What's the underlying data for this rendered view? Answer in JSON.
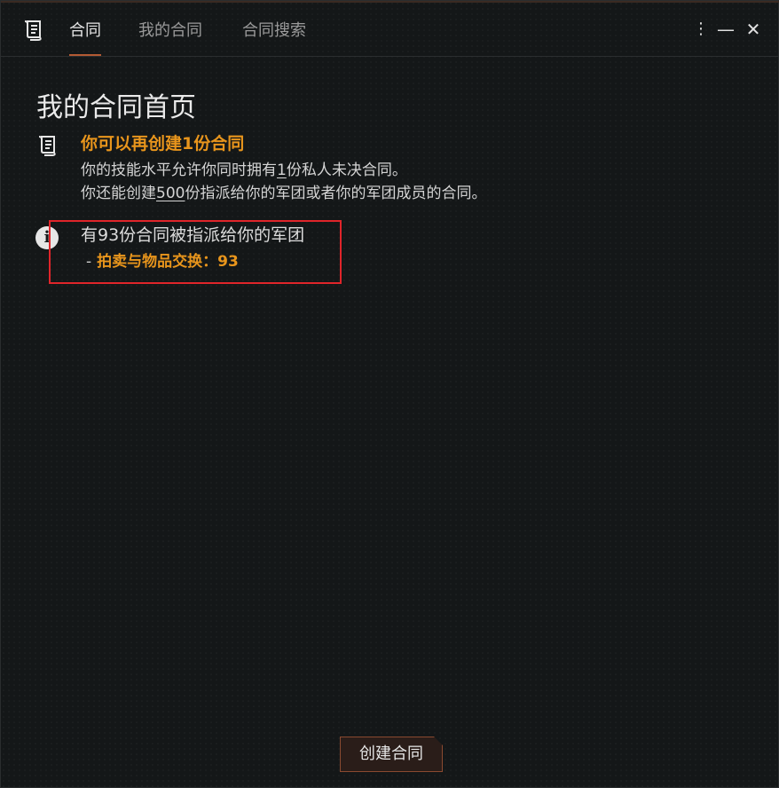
{
  "tabs": [
    {
      "label": "合同"
    },
    {
      "label": "我的合同"
    },
    {
      "label": "合同搜索"
    }
  ],
  "window_controls": {
    "more": "⋮",
    "minimize": "—",
    "close": "✕"
  },
  "main": {
    "title": "我的合同首页",
    "capacity": {
      "heading": "你可以再创建1份合同",
      "line1_prefix": "你的技能水平允许你同时拥有",
      "line1_value": "1",
      "line1_suffix": "份私人未决合同。",
      "line2_prefix": "你还能创建",
      "line2_value": "500",
      "line2_suffix": "份指派给你的军团或者你的军团成员的合同。"
    },
    "assigned": {
      "text": "有93份合同被指派给你的军团",
      "item_dash": "-",
      "item_label": "拍卖与物品交换：93"
    },
    "create_button": "创建合同"
  },
  "icons": {
    "app": "contract-scroll-icon",
    "capacity": "contract-scroll-icon",
    "info": "info-icon"
  },
  "colors": {
    "accent_orange": "#e8951c",
    "highlight_red": "#e0252a",
    "tab_underline": "#b35a33"
  }
}
